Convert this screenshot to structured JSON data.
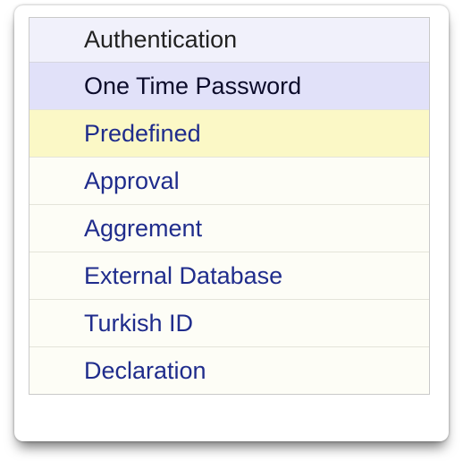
{
  "menu": {
    "header": "Authentication",
    "items": [
      {
        "label": "One Time Password",
        "state": "selected"
      },
      {
        "label": "Predefined",
        "state": "highlighted"
      },
      {
        "label": "Approval",
        "state": "normal"
      },
      {
        "label": "Aggrement",
        "state": "normal"
      },
      {
        "label": "External Database",
        "state": "normal"
      },
      {
        "label": "Turkish ID",
        "state": "normal"
      },
      {
        "label": "Declaration",
        "state": "normal"
      }
    ]
  },
  "colors": {
    "header_bg": "#f1f1fb",
    "selected_bg": "#e1e1f9",
    "highlight_bg": "#fbf8c6",
    "item_bg": "#fdfdf6",
    "link_text": "#1f2c8c"
  }
}
